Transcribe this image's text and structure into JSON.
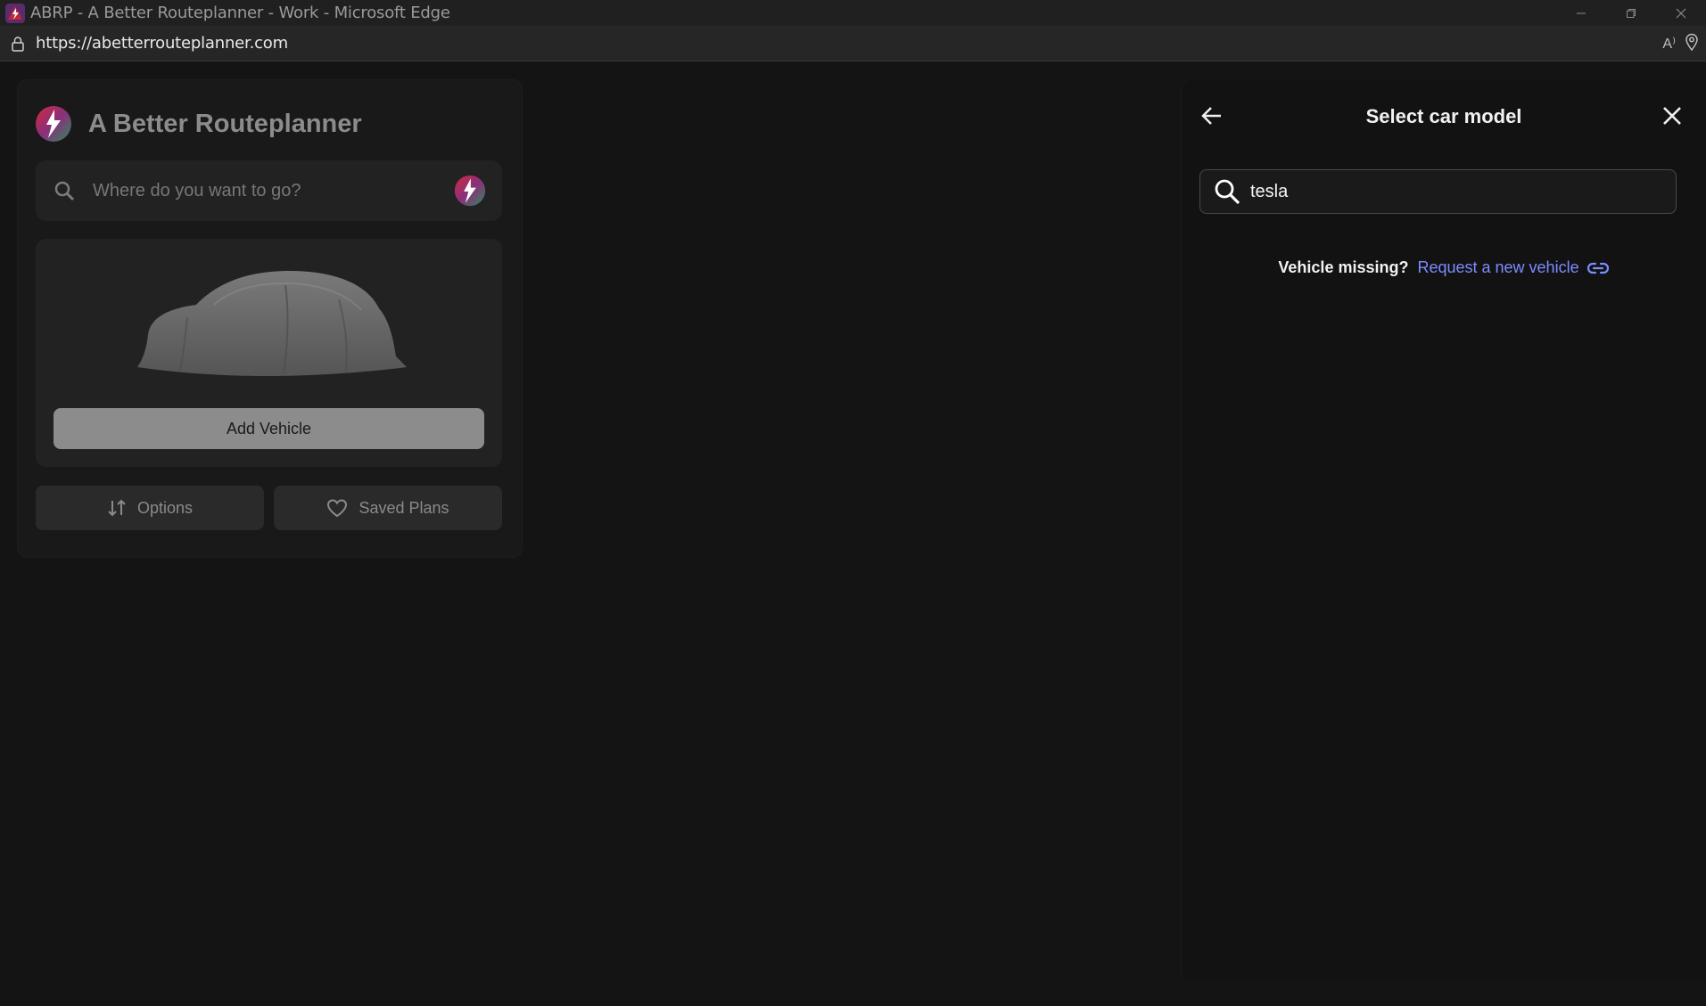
{
  "window": {
    "title": "ABRP - A Better Routeplanner - Work - Microsoft Edge"
  },
  "browser": {
    "url": "https://abetterrouteplanner.com",
    "read_aloud_label": "A⁾"
  },
  "left_panel": {
    "brand_name": "A Better Routeplanner",
    "search_placeholder": "Where do you want to go?",
    "add_vehicle_label": "Add Vehicle",
    "options_label": "Options",
    "saved_plans_label": "Saved Plans"
  },
  "right_panel": {
    "title": "Select car model",
    "search_value": "tesla",
    "vehicle_missing_text": "Vehicle missing?",
    "request_link_text": "Request a new vehicle"
  },
  "colors": {
    "background": "#141414",
    "link": "#7c8cff",
    "button_gray": "#8c8c8c"
  }
}
